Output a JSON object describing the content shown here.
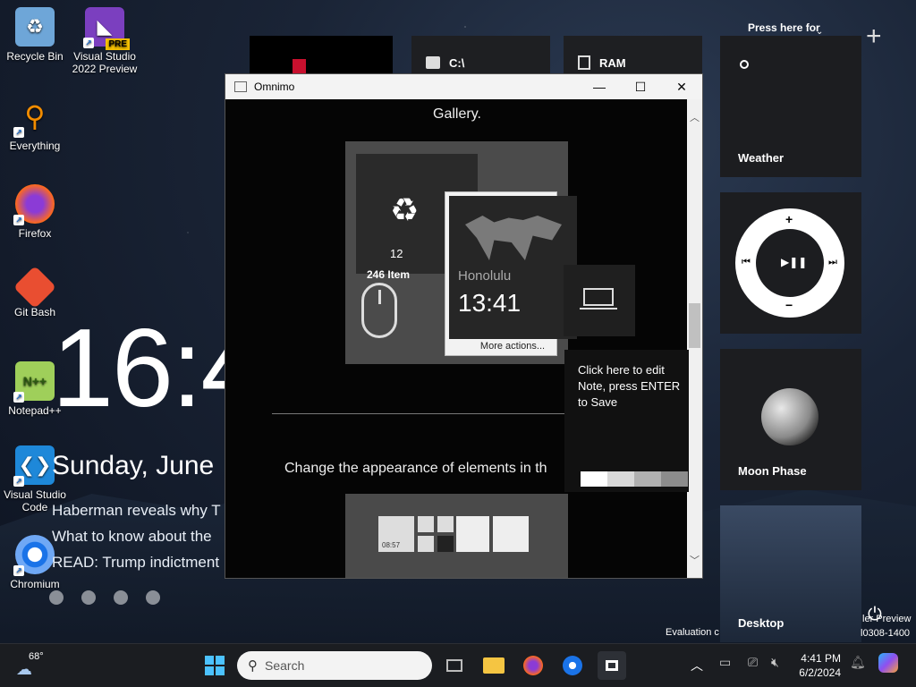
{
  "desktop": {
    "icons": [
      {
        "label": "Recycle Bin"
      },
      {
        "label": "Visual Studio 2022 Preview",
        "badge": "PRE"
      },
      {
        "label": "Everything"
      },
      {
        "label": "Firefox"
      },
      {
        "label": "Git Bash"
      },
      {
        "label": "Notepad++"
      },
      {
        "label": "Visual Studio Code"
      },
      {
        "label": "Chromium"
      }
    ],
    "clock_overlay": {
      "time": "16:4",
      "date": "Sunday, June",
      "news": [
        "Haberman reveals why T",
        "What to know about the",
        "READ: Trump indictment"
      ]
    },
    "top_tiles": {
      "drive": "C:\\",
      "ram": "RAM"
    },
    "widgets": {
      "weather_hint": "Press here for",
      "weather_label": "Weather",
      "media_plus": "+",
      "media_minus": "−",
      "moon_label": "Moon Phase",
      "desktop_label": "Desktop"
    },
    "watermark": {
      "left": "Evaluation c",
      "right_line1": "ler Preview",
      "right_line2": "l0308-1400"
    }
  },
  "window": {
    "title": "Omnimo",
    "gallery_text": "Gallery.",
    "recycle_count": "246 Item",
    "recycle_num": "12",
    "popup": {
      "city": "Honolulu",
      "time": "13:41",
      "more": "More actions..."
    },
    "change_text": "Change the appearance of elements in th",
    "mini_clock": "08:57"
  },
  "note": {
    "text": "Click here to edit Note, press ENTER to Save",
    "colors": [
      "#ffffff",
      "#d8d8d8",
      "#b0b0b0",
      "#8c8c8c"
    ]
  },
  "taskbar": {
    "weather_temp": "68°",
    "search_placeholder": "Search",
    "time": "4:41 PM",
    "date": "6/2/2024"
  }
}
